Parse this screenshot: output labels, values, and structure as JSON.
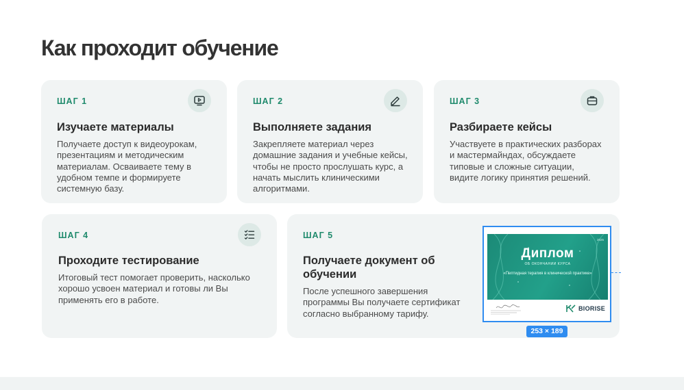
{
  "page": {
    "title": "Как проходит обучение"
  },
  "steps": [
    {
      "label": "ШАГ 1",
      "icon": "video-play-icon",
      "title": "Изучаете материалы",
      "text": "Получаете доступ к видеоурокам, презентациям и методическим материалам. Осваиваете тему в удобном темпе и формируете системную базу."
    },
    {
      "label": "ШАГ 2",
      "icon": "pencil-icon",
      "title": "Выполняете задания",
      "text": "Закрепляете материал через домашние задания и учебные кейсы, чтобы не просто прослушать курс, а начать мыслить клиническими алгоритмами."
    },
    {
      "label": "ШАГ 3",
      "icon": "briefcase-icon",
      "title": "Разбираете кейсы",
      "text": "Участвуете в практических разборах и мастермайндах, обсуждаете типовые и сложные ситуации, видите логику принятия решений."
    },
    {
      "label": "ШАГ 4",
      "icon": "checklist-icon",
      "title": "Проходите тестирование",
      "text": "Итоговый тест помогает проверить, насколько хорошо усвоен материал и готовы ли Вы применять его в работе."
    },
    {
      "label": "ШАГ 5",
      "title": "Получаете документ об обучении",
      "text": "После успешного завершения программы Вы получаете сертификат согласно выбранному тарифу."
    }
  ],
  "diploma": {
    "title": "Диплом",
    "subtitle": "об окончании курса",
    "course": "«Пептидная терапия в клинической практике»",
    "year": "2025",
    "brand": "BIORISE",
    "image_size_badge": "253 × 189"
  },
  "colors": {
    "accent": "#1f8a6c",
    "card_bg": "#f1f4f4",
    "icon_bg": "#dde9e6",
    "selection": "#2f8cf0"
  }
}
